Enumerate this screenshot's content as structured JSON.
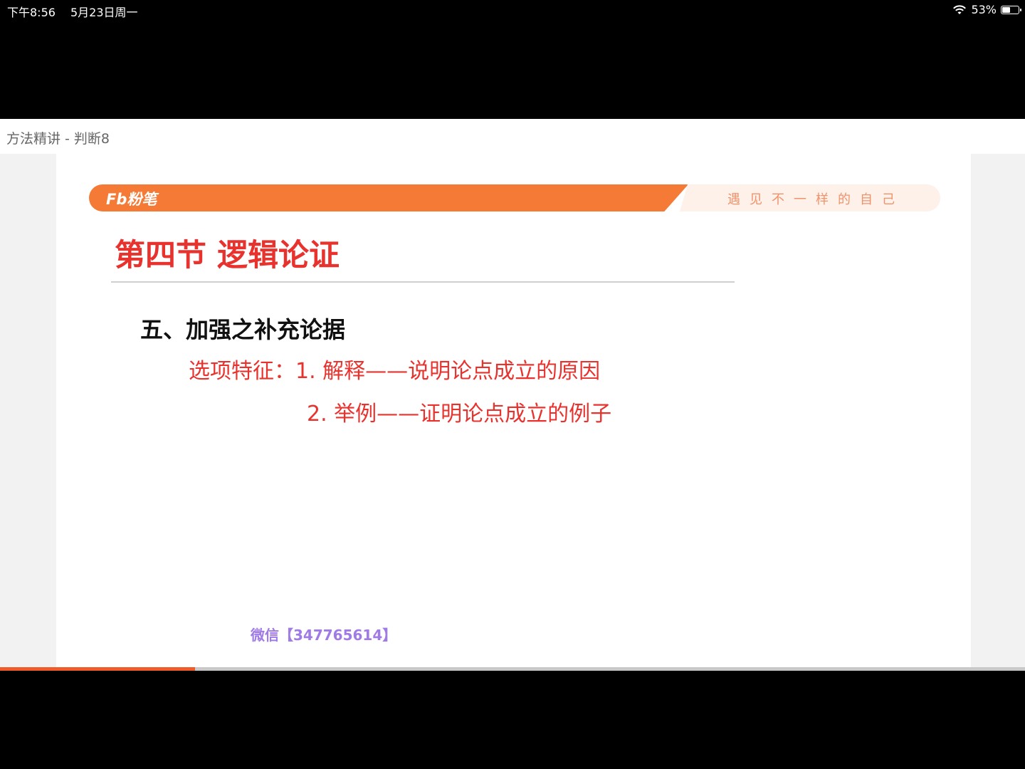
{
  "status_bar": {
    "time": "下午8:56",
    "date": "5月23日周一",
    "battery": "53%",
    "battery_level": 0.53
  },
  "video": {
    "title": "方法精讲 - 判断8",
    "progress": 0.19
  },
  "slide": {
    "logo": "Fb粉笔",
    "slogan": "遇见不一样的自己",
    "section_title": "第四节 逻辑论证",
    "heading": "五、加强之补充论据",
    "feature_line1": "选项特征：1. 解释——说明论点成立的原因",
    "feature_line2": "2. 举例——证明论点成立的例子",
    "watermark": "微信【347765614】"
  },
  "colors": {
    "accent": "#f47a36",
    "title_red": "#e8322e",
    "progress": "#f05a28"
  }
}
